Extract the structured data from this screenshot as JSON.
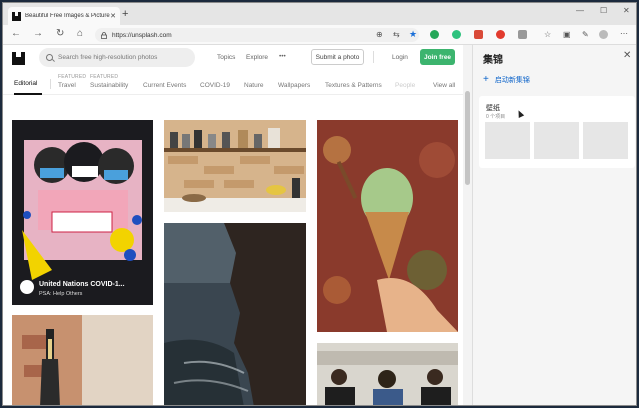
{
  "browser": {
    "tab_title": "Beautiful Free Images & Pictures",
    "tab_close": "✕",
    "new_tab": "+",
    "url": "https://unsplash.com",
    "win_min": "—",
    "win_max": "☐",
    "win_close": "✕"
  },
  "site": {
    "search_placeholder": "Search free high-resolution photos",
    "nav_topics": "Topics",
    "nav_explore": "Explore",
    "nav_more": "•••",
    "submit_label": "Submit a photo",
    "login_label": "Login",
    "join_label": "Join free",
    "categories": {
      "editorial": "Editorial",
      "featured_1": "FEATURED",
      "travel": "Travel",
      "featured_2": "FEATURED",
      "sustainability": "Sustainability",
      "current_events": "Current Events",
      "covid": "COVID-19",
      "nature": "Nature",
      "wallpapers": "Wallpapers",
      "textures": "Textures & Patterns",
      "people": "People",
      "view_all": "View all"
    },
    "sponsored": {
      "title": "United Nations COVID-1...",
      "subtitle": "PSA: Help Others"
    }
  },
  "collections_panel": {
    "title": "集锦",
    "close": "✕",
    "new_collection": "启动新集锦",
    "collection_name": "壁纸",
    "collection_count": "0 个项目"
  },
  "colors": {
    "accent_green": "#3cb46e",
    "panel_link": "#0a62c9"
  }
}
